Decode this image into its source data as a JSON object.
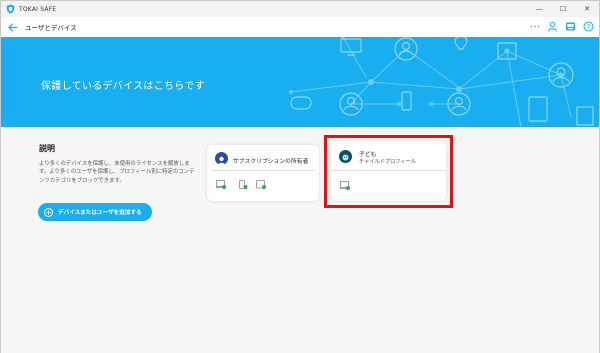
{
  "window": {
    "app_title": "TOKAI SAFE",
    "controls": [
      "—",
      "☐",
      "✕"
    ]
  },
  "nav": {
    "title": "ユーザとデバイス",
    "icons": [
      "more-icon",
      "user-icon",
      "devices-icon",
      "help-icon"
    ]
  },
  "hero": {
    "title": "保護しているデバイスはこちらです"
  },
  "description": {
    "heading": "説明",
    "body": "より多くのデバイスを保護し、未使用のライセンスを解放します。より多くのユーザを保護し、プロフィール別に特定のコンテンツカテゴリをブロックできます。",
    "add_button_label": "デバイスまたはユーザを追加する"
  },
  "cards": {
    "owner": {
      "name": "サブスクリプションの所有者",
      "device_icons": [
        "laptop-icon",
        "phone-icon",
        "tablet-icon"
      ]
    },
    "child": {
      "name": "子ども",
      "subtitle": "チャイルドプロフィール",
      "device_icons": [
        "laptop-icon"
      ]
    }
  },
  "colors": {
    "brand": "#18aef0",
    "highlight": "#e81010",
    "check": "#2bb14a"
  }
}
